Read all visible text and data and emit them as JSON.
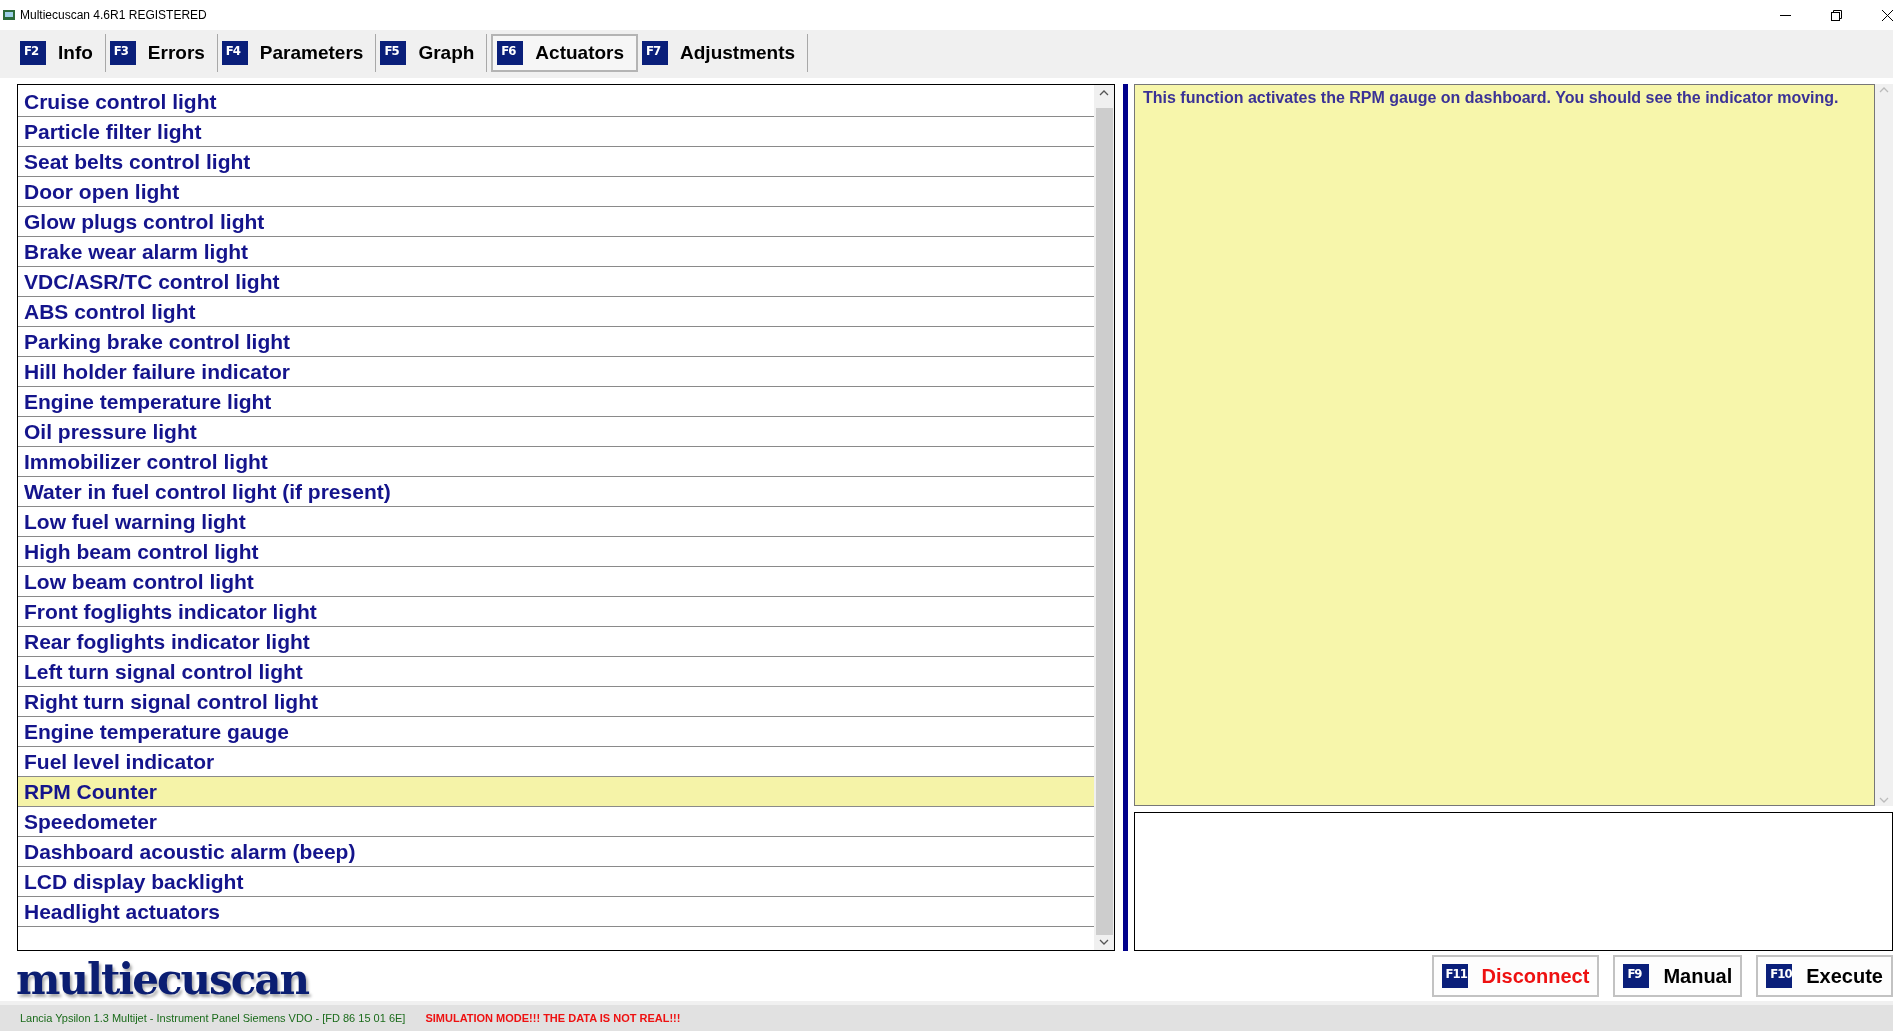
{
  "window": {
    "title": "Multiecuscan 4.6R1 REGISTERED"
  },
  "tabs": [
    {
      "key": "F2",
      "label": "Info",
      "selected": false
    },
    {
      "key": "F3",
      "label": "Errors",
      "selected": false
    },
    {
      "key": "F4",
      "label": "Parameters",
      "selected": false
    },
    {
      "key": "F5",
      "label": "Graph",
      "selected": false
    },
    {
      "key": "F6",
      "label": "Actuators",
      "selected": true
    },
    {
      "key": "F7",
      "label": "Adjustments",
      "selected": false
    }
  ],
  "actuators": [
    {
      "label": "Cruise control light",
      "selected": false
    },
    {
      "label": "Particle filter light",
      "selected": false
    },
    {
      "label": "Seat belts control light",
      "selected": false
    },
    {
      "label": "Door open light",
      "selected": false
    },
    {
      "label": "Glow plugs control light",
      "selected": false
    },
    {
      "label": "Brake wear alarm light",
      "selected": false
    },
    {
      "label": "VDC/ASR/TC control light",
      "selected": false
    },
    {
      "label": "ABS control light",
      "selected": false
    },
    {
      "label": "Parking brake control light",
      "selected": false
    },
    {
      "label": "Hill holder failure indicator",
      "selected": false
    },
    {
      "label": "Engine temperature light",
      "selected": false
    },
    {
      "label": "Oil pressure light",
      "selected": false
    },
    {
      "label": "Immobilizer control light",
      "selected": false
    },
    {
      "label": "Water in fuel control light (if present)",
      "selected": false
    },
    {
      "label": "Low fuel warning light",
      "selected": false
    },
    {
      "label": "High beam control light",
      "selected": false
    },
    {
      "label": "Low beam control light",
      "selected": false
    },
    {
      "label": "Front foglights indicator light",
      "selected": false
    },
    {
      "label": "Rear foglights indicator light",
      "selected": false
    },
    {
      "label": "Left turn signal control light",
      "selected": false
    },
    {
      "label": "Right turn signal control light",
      "selected": false
    },
    {
      "label": "Engine temperature gauge",
      "selected": false
    },
    {
      "label": "Fuel level indicator",
      "selected": false
    },
    {
      "label": "RPM Counter",
      "selected": true
    },
    {
      "label": "Speedometer",
      "selected": false
    },
    {
      "label": "Dashboard acoustic alarm (beep)",
      "selected": false
    },
    {
      "label": "LCD display backlight",
      "selected": false
    },
    {
      "label": "Headlight actuators",
      "selected": false
    }
  ],
  "description": "This function activates the RPM gauge on dashboard. You should see the indicator moving.",
  "logo": "multiecuscan",
  "buttons": [
    {
      "key": "F11",
      "label": "Disconnect",
      "kind": "danger"
    },
    {
      "key": "F9",
      "label": "Manual",
      "kind": "normal"
    },
    {
      "key": "F10",
      "label": "Execute",
      "kind": "normal"
    }
  ],
  "status_bar": {
    "vehicle": "Lancia Ypsilon 1.3 Multijet - Instrument Panel Siemens VDO - [FD 86 15 01 6E]",
    "warning": "SIMULATION MODE!!! THE DATA IS NOT REAL!!!"
  }
}
